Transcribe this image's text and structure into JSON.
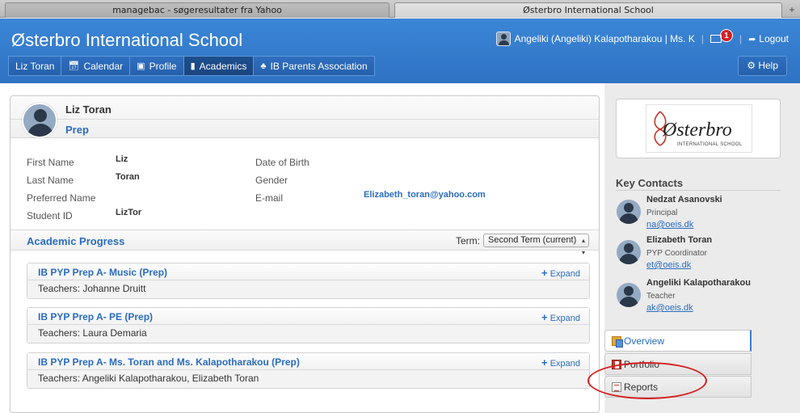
{
  "browser": {
    "tabs": [
      {
        "label": "managebac - søgeresultater fra Yahoo",
        "active": false
      },
      {
        "label": "Østerbro International School",
        "active": true
      }
    ],
    "new_tab": "+"
  },
  "header": {
    "school_name": "Østerbro International School",
    "user": "Angeliki (Angeliki) Kalapotharakou | Ms. K",
    "separator": "|",
    "message_count": "1",
    "logout": "Logout",
    "help": "Help"
  },
  "nav": {
    "items": [
      {
        "label": "Liz Toran",
        "icon": "none"
      },
      {
        "label": "Calendar",
        "icon": "calendar-icon"
      },
      {
        "label": "Profile",
        "icon": "profile-card-icon"
      },
      {
        "label": "Academics",
        "icon": "book-icon",
        "active": true
      },
      {
        "label": "IB Parents Association",
        "icon": "group-icon"
      }
    ]
  },
  "student": {
    "name": "Liz Toran",
    "grade": "Prep",
    "fields": {
      "first_name_label": "First Name",
      "first_name": "Liz",
      "last_name_label": "Last Name",
      "last_name": "Toran",
      "preferred_name_label": "Preferred Name",
      "student_id_label": "Student ID",
      "student_id": "LizTor",
      "dob_label": "Date of Birth",
      "gender_label": "Gender",
      "email_label": "E-mail",
      "email": "Elizabeth_toran@yahoo.com"
    }
  },
  "progress": {
    "title": "Academic Progress",
    "term_label": "Term:",
    "term_value": "Second Term (current)",
    "courses": [
      {
        "title": "IB PYP Prep A- Music (Prep)",
        "teachers": "Teachers: Johanne Druitt",
        "expand": "Expand"
      },
      {
        "title": "IB PYP Prep A- PE (Prep)",
        "teachers": "Teachers: Laura Demaria",
        "expand": "Expand"
      },
      {
        "title": "IB PYP Prep A- Ms. Toran and Ms. Kalapotharakou (Prep)",
        "teachers": "Teachers: Angeliki Kalapotharakou, Elizabeth Toran",
        "expand": "Expand"
      }
    ]
  },
  "logo": {
    "word": "Østerbro",
    "sub": "INTERNATIONAL SCHOOL"
  },
  "key_contacts": {
    "title": "Key Contacts",
    "contacts": [
      {
        "name": "Nedzat Asanovski",
        "role": "Principal",
        "email": "na@oeis.dk"
      },
      {
        "name": "Elizabeth Toran",
        "role": "PYP Coordinator",
        "email": "et@oeis.dk"
      },
      {
        "name": "Angeliki Kalapotharakou",
        "role": "Teacher",
        "email": "ak@oeis.dk"
      }
    ]
  },
  "side_tabs": [
    {
      "label": "Overview",
      "active": true
    },
    {
      "label": "Portfolio",
      "active": false
    },
    {
      "label": "Reports",
      "active": false
    }
  ],
  "colors": {
    "header_blue": "#3b86d6",
    "link_blue": "#2a6cc0",
    "annotation_red": "#d42020"
  }
}
